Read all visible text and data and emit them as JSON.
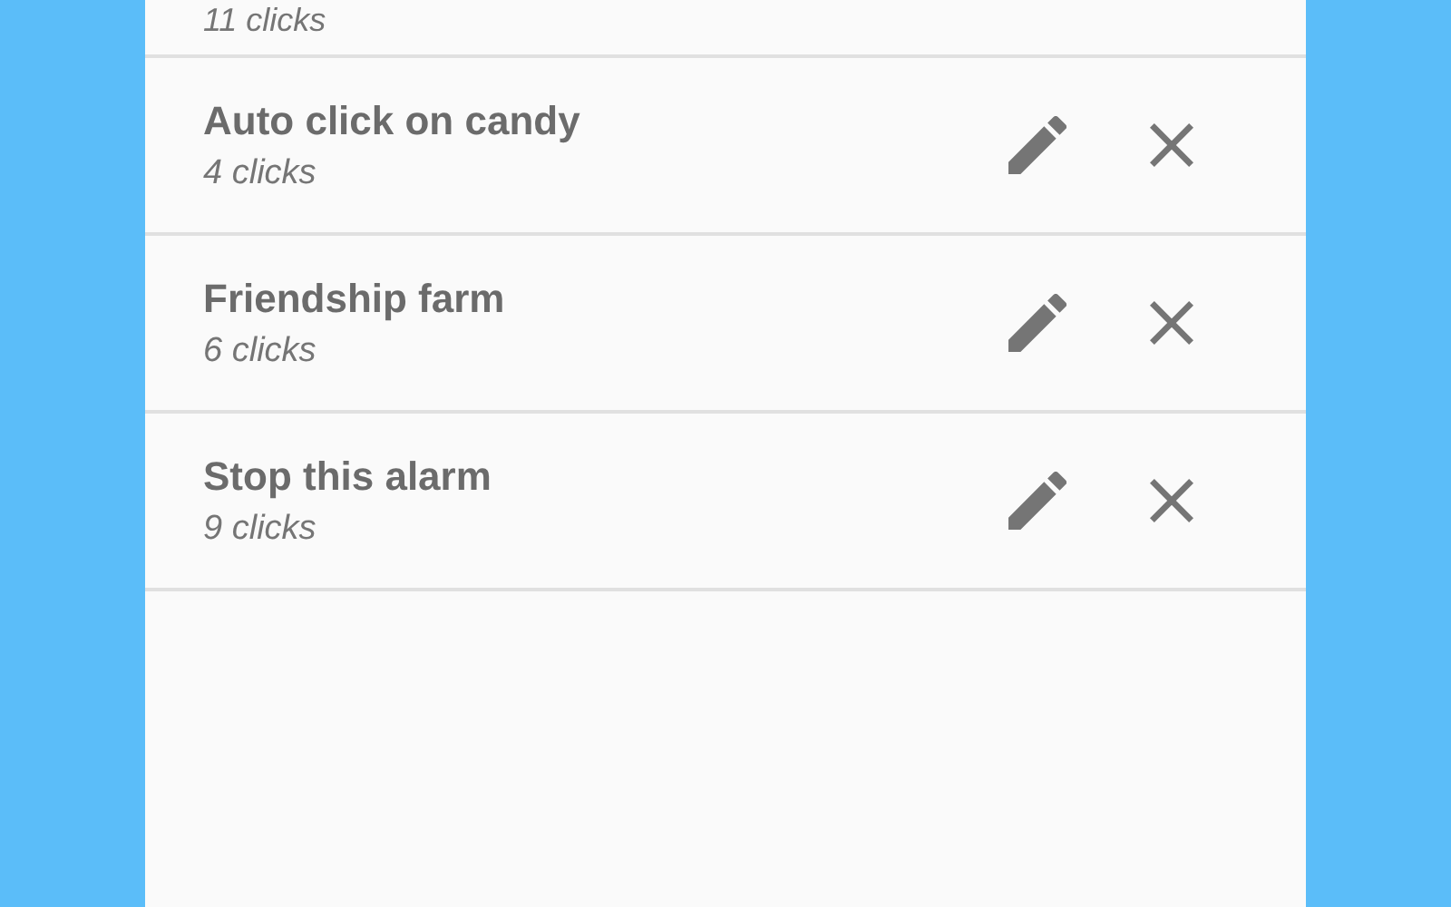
{
  "items": [
    {
      "subtitle": "11 clicks"
    },
    {
      "title": "Auto click on candy",
      "subtitle": "4 clicks"
    },
    {
      "title": "Friendship farm",
      "subtitle": "6 clicks"
    },
    {
      "title": "Stop this alarm",
      "subtitle": "9 clicks"
    }
  ]
}
